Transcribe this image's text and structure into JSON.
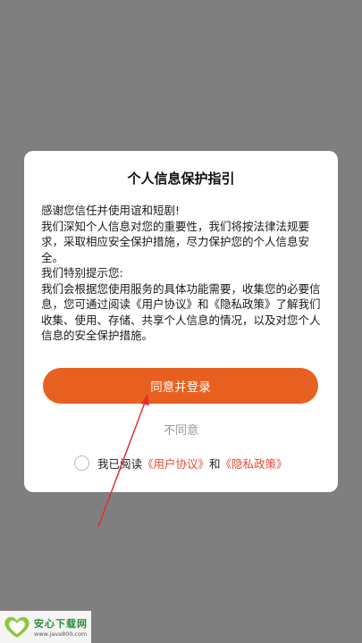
{
  "dialog": {
    "title": "个人信息保护指引",
    "paragraphs": [
      "感谢您信任并使用谊和短剧!",
      "我们深知个人信息对您的重要性，我们将按法律法规要求，采取相应安全保护措施，尽力保护您的个人信息安全。",
      "我们特别提示您:",
      "我们会根据您使用服务的具体功能需要，收集您的必要信息，您可通过阅读《用户协议》和《隐私政策》了解我们收集、使用、存储、共享个人信息的情况，以及对您个人信息的安全保护措施。"
    ],
    "agree_button": "同意并登录",
    "disagree_button": "不同意",
    "consent": {
      "prefix": "我已阅读",
      "user_agreement": "《用户协议》",
      "and": "和",
      "privacy_policy": "《隐私政策》",
      "checked": false
    }
  },
  "watermark": {
    "name": "安心下载网",
    "url": "www.java800.com"
  },
  "colors": {
    "accent": "#e8601f",
    "link": "#e84a3a",
    "overlay": "#7f7f7f"
  }
}
